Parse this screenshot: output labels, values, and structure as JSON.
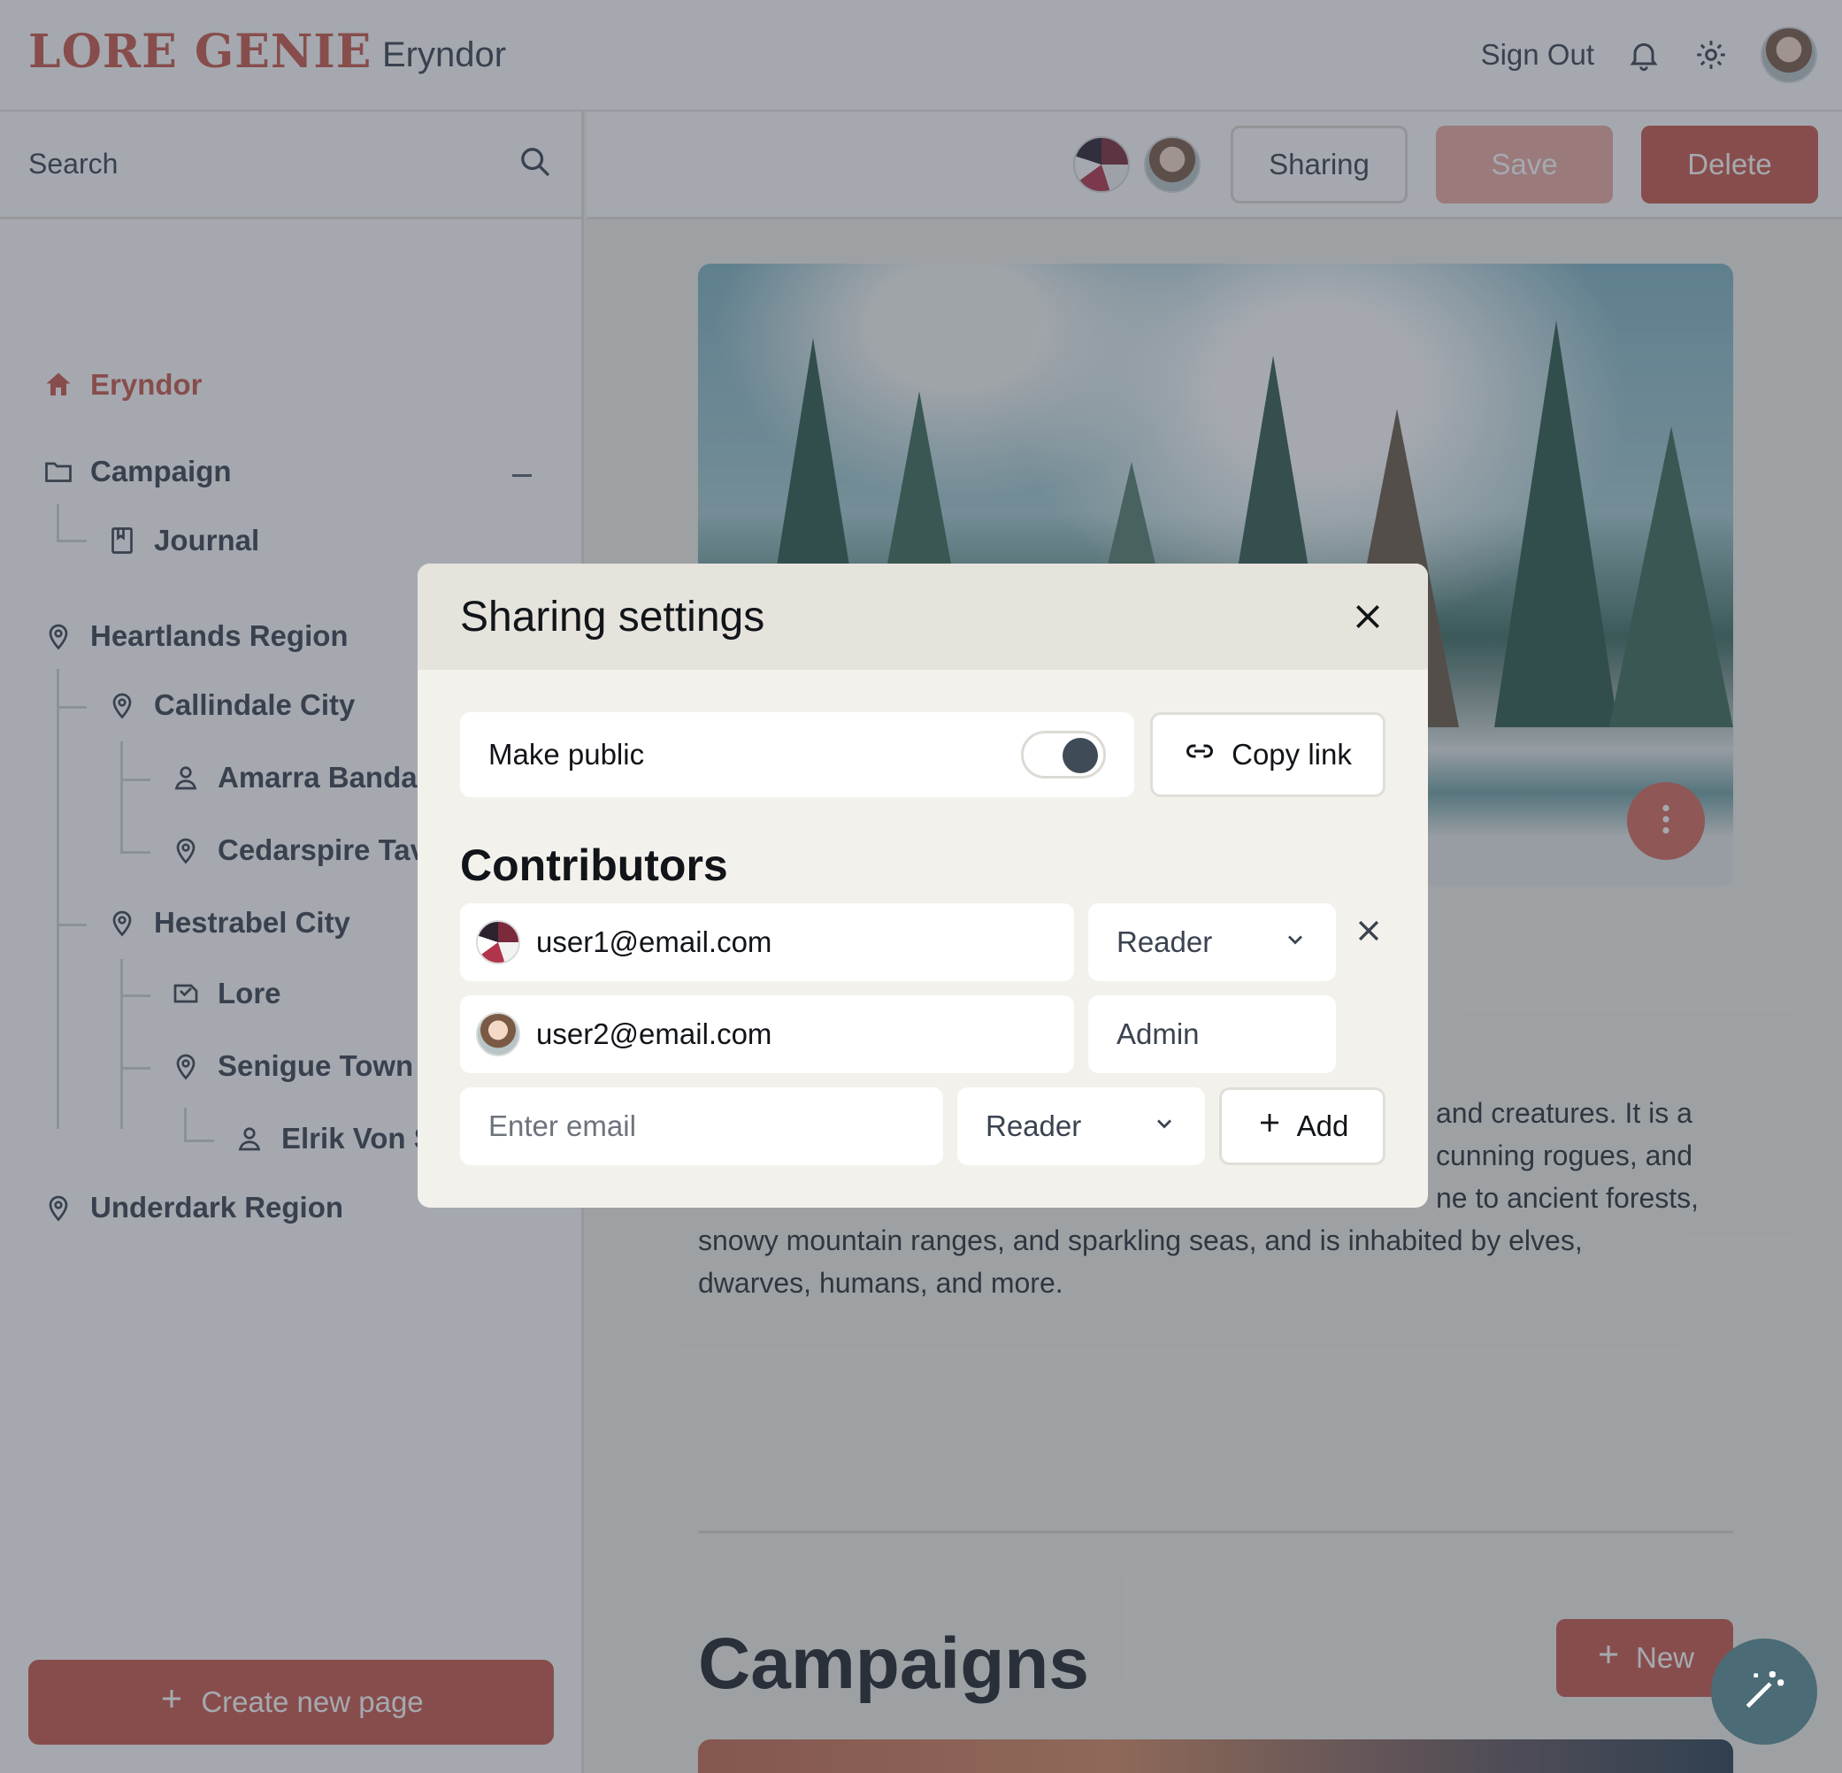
{
  "header": {
    "logo": "LORE GENIE",
    "world_title": "Eryndor",
    "signout": "Sign Out"
  },
  "sidebar": {
    "search_placeholder": "Search",
    "items": [
      {
        "label": "Eryndor",
        "icon": "home-icon"
      },
      {
        "label": "Campaign",
        "icon": "folder-icon"
      },
      {
        "label": "Journal",
        "icon": "journal-icon"
      },
      {
        "label": "Heartlands Region",
        "icon": "location-pin-icon"
      },
      {
        "label": "Callindale City",
        "icon": "location-pin-icon"
      },
      {
        "label": "Amarra Bandar",
        "icon": "person-icon"
      },
      {
        "label": "Cedarspire Tav",
        "icon": "location-pin-icon"
      },
      {
        "label": "Hestrabel City",
        "icon": "location-pin-icon"
      },
      {
        "label": "Lore",
        "icon": "lore-icon"
      },
      {
        "label": "Senigue Town",
        "icon": "location-pin-icon"
      },
      {
        "label": "Elrik Von S",
        "icon": "person-icon"
      },
      {
        "label": "Underdark Region",
        "icon": "location-pin-icon"
      }
    ],
    "create_page": "Create new page"
  },
  "toolbar": {
    "sharing": "Sharing",
    "save": "Save",
    "delete": "Delete"
  },
  "main": {
    "description": "and creatures. It is a … cunning rogues, and … ne to ancient forests, snowy mountain ranges, and sparkling seas, and is inhabited by elves, dwarves, humans, and more.",
    "desc_lines": [
      "and creatures. It is a",
      "cunning rogues, and",
      "ne to ancient forests,",
      "snowy mountain ranges, and sparkling seas, and is inhabited by elves,",
      "dwarves, humans, and more."
    ],
    "campaigns_title": "Campaigns",
    "new_label": "New"
  },
  "modal": {
    "title": "Sharing settings",
    "make_public": "Make public",
    "make_public_on": true,
    "copy_link": "Copy link",
    "contributors_title": "Contributors",
    "contributors": [
      {
        "email": "user1@email.com",
        "role": "Reader"
      },
      {
        "email": "user2@email.com",
        "role": "Admin"
      }
    ],
    "email_placeholder": "Enter email",
    "new_role": "Reader",
    "add": "Add"
  },
  "colors": {
    "brand": "#c8584c",
    "overlay": "#37414e"
  }
}
